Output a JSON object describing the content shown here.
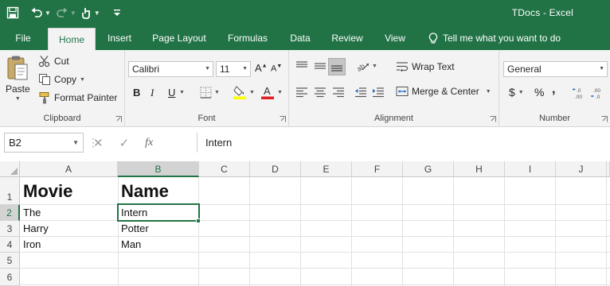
{
  "window": {
    "title": "TDocs  -  Excel"
  },
  "tabs": [
    {
      "label": "File"
    },
    {
      "label": "Home"
    },
    {
      "label": "Insert"
    },
    {
      "label": "Page Layout"
    },
    {
      "label": "Formulas"
    },
    {
      "label": "Data"
    },
    {
      "label": "Review"
    },
    {
      "label": "View"
    }
  ],
  "tell_me": "Tell me what you want to do",
  "clipboard": {
    "paste": "Paste",
    "cut": "Cut",
    "copy": "Copy",
    "format_painter": "Format Painter",
    "group_label": "Clipboard"
  },
  "font": {
    "family": "Calibri",
    "size": "11",
    "group_label": "Font",
    "bold": "B",
    "italic": "I",
    "underline": "U"
  },
  "alignment": {
    "wrap_text": "Wrap Text",
    "merge_center": "Merge & Center",
    "group_label": "Alignment"
  },
  "number": {
    "format": "General",
    "currency": "$",
    "percent": "%",
    "comma": ",",
    "group_label": "Number"
  },
  "formula_bar": {
    "name_box": "B2",
    "content": "Intern",
    "fx": "fx"
  },
  "sheet": {
    "columns": [
      "A",
      "B",
      "C",
      "D",
      "E",
      "F",
      "G",
      "H",
      "I",
      "J"
    ],
    "rows": [
      "1",
      "2",
      "3",
      "4",
      "5",
      "6"
    ],
    "cells": {
      "A1": "Movie",
      "B1": "Name",
      "A2": "The",
      "B2": "Intern",
      "A3": "Harry",
      "B3": "Potter",
      "A4": "Iron",
      "B4": "Man"
    },
    "active_cell": "B2"
  },
  "colors": {
    "accent": "#217346",
    "ribbon_bg": "#f3f3f3"
  }
}
